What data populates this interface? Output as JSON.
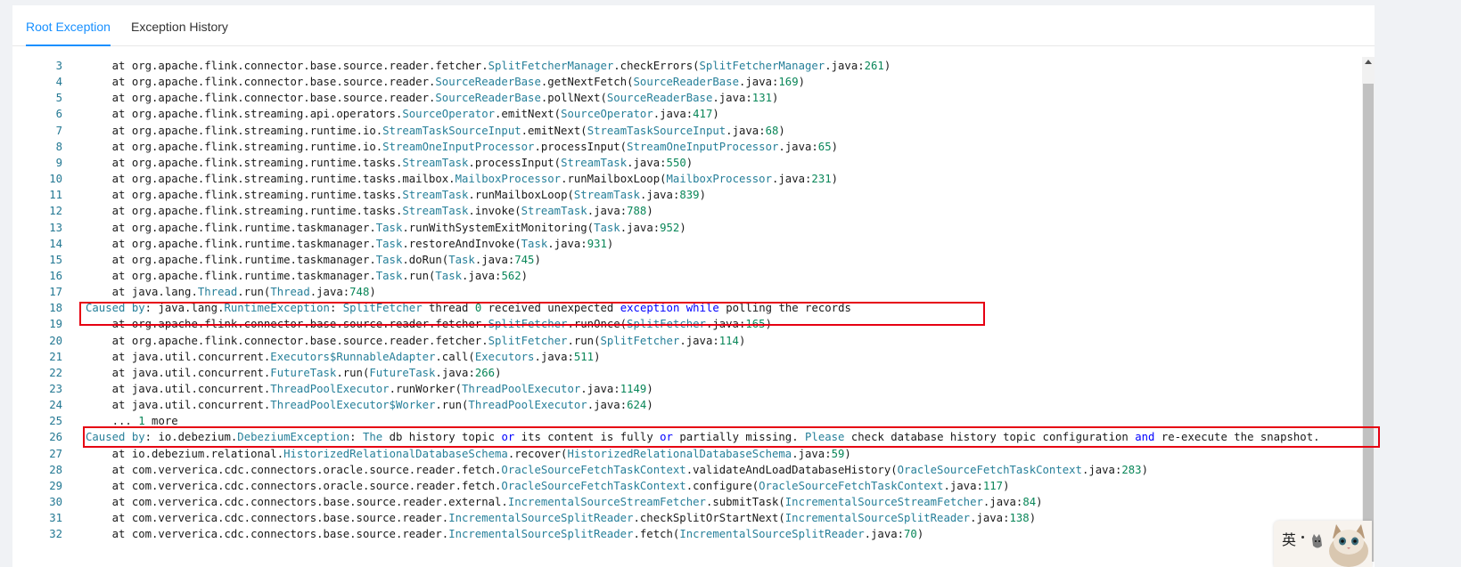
{
  "tabs": [
    {
      "label": "Root Exception",
      "active": true
    },
    {
      "label": "Exception History",
      "active": false
    }
  ],
  "colors": {
    "accent": "#1890ff",
    "line_number": "#237893",
    "class_token": "#267f99",
    "number_token": "#098658",
    "keyword_token": "#0000ff",
    "highlight_box": "#e60012"
  },
  "editor": {
    "highlighted_lines": [
      "18",
      "26"
    ],
    "lines": [
      {
        "num": "3",
        "tokens": [
          {
            "t": "    at org.apache.flink.connector.base.source.reader.fetcher."
          },
          {
            "t": "SplitFetcherManager",
            "s": "c"
          },
          {
            "t": ".checkErrors("
          },
          {
            "t": "SplitFetcherManager",
            "s": "c"
          },
          {
            "t": ".java:"
          },
          {
            "t": "261",
            "s": "n"
          },
          {
            "t": ")"
          }
        ]
      },
      {
        "num": "4",
        "tokens": [
          {
            "t": "    at org.apache.flink.connector.base.source.reader."
          },
          {
            "t": "SourceReaderBase",
            "s": "c"
          },
          {
            "t": ".getNextFetch("
          },
          {
            "t": "SourceReaderBase",
            "s": "c"
          },
          {
            "t": ".java:"
          },
          {
            "t": "169",
            "s": "n"
          },
          {
            "t": ")"
          }
        ]
      },
      {
        "num": "5",
        "tokens": [
          {
            "t": "    at org.apache.flink.connector.base.source.reader."
          },
          {
            "t": "SourceReaderBase",
            "s": "c"
          },
          {
            "t": ".pollNext("
          },
          {
            "t": "SourceReaderBase",
            "s": "c"
          },
          {
            "t": ".java:"
          },
          {
            "t": "131",
            "s": "n"
          },
          {
            "t": ")"
          }
        ]
      },
      {
        "num": "6",
        "tokens": [
          {
            "t": "    at org.apache.flink.streaming.api.operators."
          },
          {
            "t": "SourceOperator",
            "s": "c"
          },
          {
            "t": ".emitNext("
          },
          {
            "t": "SourceOperator",
            "s": "c"
          },
          {
            "t": ".java:"
          },
          {
            "t": "417",
            "s": "n"
          },
          {
            "t": ")"
          }
        ]
      },
      {
        "num": "7",
        "tokens": [
          {
            "t": "    at org.apache.flink.streaming.runtime.io."
          },
          {
            "t": "StreamTaskSourceInput",
            "s": "c"
          },
          {
            "t": ".emitNext("
          },
          {
            "t": "StreamTaskSourceInput",
            "s": "c"
          },
          {
            "t": ".java:"
          },
          {
            "t": "68",
            "s": "n"
          },
          {
            "t": ")"
          }
        ]
      },
      {
        "num": "8",
        "tokens": [
          {
            "t": "    at org.apache.flink.streaming.runtime.io."
          },
          {
            "t": "StreamOneInputProcessor",
            "s": "c"
          },
          {
            "t": ".processInput("
          },
          {
            "t": "StreamOneInputProcessor",
            "s": "c"
          },
          {
            "t": ".java:"
          },
          {
            "t": "65",
            "s": "n"
          },
          {
            "t": ")"
          }
        ]
      },
      {
        "num": "9",
        "tokens": [
          {
            "t": "    at org.apache.flink.streaming.runtime.tasks."
          },
          {
            "t": "StreamTask",
            "s": "c"
          },
          {
            "t": ".processInput("
          },
          {
            "t": "StreamTask",
            "s": "c"
          },
          {
            "t": ".java:"
          },
          {
            "t": "550",
            "s": "n"
          },
          {
            "t": ")"
          }
        ]
      },
      {
        "num": "10",
        "tokens": [
          {
            "t": "    at org.apache.flink.streaming.runtime.tasks.mailbox."
          },
          {
            "t": "MailboxProcessor",
            "s": "c"
          },
          {
            "t": ".runMailboxLoop("
          },
          {
            "t": "MailboxProcessor",
            "s": "c"
          },
          {
            "t": ".java:"
          },
          {
            "t": "231",
            "s": "n"
          },
          {
            "t": ")"
          }
        ]
      },
      {
        "num": "11",
        "tokens": [
          {
            "t": "    at org.apache.flink.streaming.runtime.tasks."
          },
          {
            "t": "StreamTask",
            "s": "c"
          },
          {
            "t": ".runMailboxLoop("
          },
          {
            "t": "StreamTask",
            "s": "c"
          },
          {
            "t": ".java:"
          },
          {
            "t": "839",
            "s": "n"
          },
          {
            "t": ")"
          }
        ]
      },
      {
        "num": "12",
        "tokens": [
          {
            "t": "    at org.apache.flink.streaming.runtime.tasks."
          },
          {
            "t": "StreamTask",
            "s": "c"
          },
          {
            "t": ".invoke("
          },
          {
            "t": "StreamTask",
            "s": "c"
          },
          {
            "t": ".java:"
          },
          {
            "t": "788",
            "s": "n"
          },
          {
            "t": ")"
          }
        ]
      },
      {
        "num": "13",
        "tokens": [
          {
            "t": "    at org.apache.flink.runtime.taskmanager."
          },
          {
            "t": "Task",
            "s": "c"
          },
          {
            "t": ".runWithSystemExitMonitoring("
          },
          {
            "t": "Task",
            "s": "c"
          },
          {
            "t": ".java:"
          },
          {
            "t": "952",
            "s": "n"
          },
          {
            "t": ")"
          }
        ]
      },
      {
        "num": "14",
        "tokens": [
          {
            "t": "    at org.apache.flink.runtime.taskmanager."
          },
          {
            "t": "Task",
            "s": "c"
          },
          {
            "t": ".restoreAndInvoke("
          },
          {
            "t": "Task",
            "s": "c"
          },
          {
            "t": ".java:"
          },
          {
            "t": "931",
            "s": "n"
          },
          {
            "t": ")"
          }
        ]
      },
      {
        "num": "15",
        "tokens": [
          {
            "t": "    at org.apache.flink.runtime.taskmanager."
          },
          {
            "t": "Task",
            "s": "c"
          },
          {
            "t": ".doRun("
          },
          {
            "t": "Task",
            "s": "c"
          },
          {
            "t": ".java:"
          },
          {
            "t": "745",
            "s": "n"
          },
          {
            "t": ")"
          }
        ]
      },
      {
        "num": "16",
        "tokens": [
          {
            "t": "    at org.apache.flink.runtime.taskmanager."
          },
          {
            "t": "Task",
            "s": "c"
          },
          {
            "t": ".run("
          },
          {
            "t": "Task",
            "s": "c"
          },
          {
            "t": ".java:"
          },
          {
            "t": "562",
            "s": "n"
          },
          {
            "t": ")"
          }
        ]
      },
      {
        "num": "17",
        "tokens": [
          {
            "t": "    at java.lang."
          },
          {
            "t": "Thread",
            "s": "c"
          },
          {
            "t": ".run("
          },
          {
            "t": "Thread",
            "s": "c"
          },
          {
            "t": ".java:"
          },
          {
            "t": "748",
            "s": "n"
          },
          {
            "t": ")"
          }
        ]
      },
      {
        "num": "18",
        "tokens": [
          {
            "t": "Caused by",
            "s": "c"
          },
          {
            "t": ": java.lang."
          },
          {
            "t": "RuntimeException",
            "s": "c"
          },
          {
            "t": ": "
          },
          {
            "t": "SplitFetcher",
            "s": "c"
          },
          {
            "t": " thread "
          },
          {
            "t": "0",
            "s": "n"
          },
          {
            "t": " received unexpected "
          },
          {
            "t": "exception",
            "s": "k"
          },
          {
            "t": " "
          },
          {
            "t": "while",
            "s": "k"
          },
          {
            "t": " polling the records"
          }
        ]
      },
      {
        "num": "19",
        "tokens": [
          {
            "t": "    at org.apache.flink.connector.base.source.reader.fetcher."
          },
          {
            "t": "SplitFetcher",
            "s": "c"
          },
          {
            "t": ".runOnce("
          },
          {
            "t": "SplitFetcher",
            "s": "c"
          },
          {
            "t": ".java:"
          },
          {
            "t": "165",
            "s": "n"
          },
          {
            "t": ")"
          }
        ]
      },
      {
        "num": "20",
        "tokens": [
          {
            "t": "    at org.apache.flink.connector.base.source.reader.fetcher."
          },
          {
            "t": "SplitFetcher",
            "s": "c"
          },
          {
            "t": ".run("
          },
          {
            "t": "SplitFetcher",
            "s": "c"
          },
          {
            "t": ".java:"
          },
          {
            "t": "114",
            "s": "n"
          },
          {
            "t": ")"
          }
        ]
      },
      {
        "num": "21",
        "tokens": [
          {
            "t": "    at java.util.concurrent."
          },
          {
            "t": "Executors$RunnableAdapter",
            "s": "c"
          },
          {
            "t": ".call("
          },
          {
            "t": "Executors",
            "s": "c"
          },
          {
            "t": ".java:"
          },
          {
            "t": "511",
            "s": "n"
          },
          {
            "t": ")"
          }
        ]
      },
      {
        "num": "22",
        "tokens": [
          {
            "t": "    at java.util.concurrent."
          },
          {
            "t": "FutureTask",
            "s": "c"
          },
          {
            "t": ".run("
          },
          {
            "t": "FutureTask",
            "s": "c"
          },
          {
            "t": ".java:"
          },
          {
            "t": "266",
            "s": "n"
          },
          {
            "t": ")"
          }
        ]
      },
      {
        "num": "23",
        "tokens": [
          {
            "t": "    at java.util.concurrent."
          },
          {
            "t": "ThreadPoolExecutor",
            "s": "c"
          },
          {
            "t": ".runWorker("
          },
          {
            "t": "ThreadPoolExecutor",
            "s": "c"
          },
          {
            "t": ".java:"
          },
          {
            "t": "1149",
            "s": "n"
          },
          {
            "t": ")"
          }
        ]
      },
      {
        "num": "24",
        "tokens": [
          {
            "t": "    at java.util.concurrent."
          },
          {
            "t": "ThreadPoolExecutor$Worker",
            "s": "c"
          },
          {
            "t": ".run("
          },
          {
            "t": "ThreadPoolExecutor",
            "s": "c"
          },
          {
            "t": ".java:"
          },
          {
            "t": "624",
            "s": "n"
          },
          {
            "t": ")"
          }
        ]
      },
      {
        "num": "25",
        "tokens": [
          {
            "t": "    ... "
          },
          {
            "t": "1",
            "s": "n"
          },
          {
            "t": " more"
          }
        ]
      },
      {
        "num": "26",
        "tokens": [
          {
            "t": "Caused by",
            "s": "c"
          },
          {
            "t": ": io.debezium."
          },
          {
            "t": "DebeziumException",
            "s": "c"
          },
          {
            "t": ": "
          },
          {
            "t": "The",
            "s": "c"
          },
          {
            "t": " db history topic "
          },
          {
            "t": "or",
            "s": "k"
          },
          {
            "t": " its content is fully "
          },
          {
            "t": "or",
            "s": "k"
          },
          {
            "t": " partially missing. "
          },
          {
            "t": "Please",
            "s": "c"
          },
          {
            "t": " check database history topic configuration "
          },
          {
            "t": "and",
            "s": "k"
          },
          {
            "t": " re-execute the snapshot."
          }
        ]
      },
      {
        "num": "27",
        "tokens": [
          {
            "t": "    at io.debezium.relational."
          },
          {
            "t": "HistorizedRelationalDatabaseSchema",
            "s": "c"
          },
          {
            "t": ".recover("
          },
          {
            "t": "HistorizedRelationalDatabaseSchema",
            "s": "c"
          },
          {
            "t": ".java:"
          },
          {
            "t": "59",
            "s": "n"
          },
          {
            "t": ")"
          }
        ]
      },
      {
        "num": "28",
        "tokens": [
          {
            "t": "    at com.ververica.cdc.connectors.oracle.source.reader.fetch."
          },
          {
            "t": "OracleSourceFetchTaskContext",
            "s": "c"
          },
          {
            "t": ".validateAndLoadDatabaseHistory("
          },
          {
            "t": "OracleSourceFetchTaskContext",
            "s": "c"
          },
          {
            "t": ".java:"
          },
          {
            "t": "283",
            "s": "n"
          },
          {
            "t": ")"
          }
        ]
      },
      {
        "num": "29",
        "tokens": [
          {
            "t": "    at com.ververica.cdc.connectors.oracle.source.reader.fetch."
          },
          {
            "t": "OracleSourceFetchTaskContext",
            "s": "c"
          },
          {
            "t": ".configure("
          },
          {
            "t": "OracleSourceFetchTaskContext",
            "s": "c"
          },
          {
            "t": ".java:"
          },
          {
            "t": "117",
            "s": "n"
          },
          {
            "t": ")"
          }
        ]
      },
      {
        "num": "30",
        "tokens": [
          {
            "t": "    at com.ververica.cdc.connectors.base.source.reader.external."
          },
          {
            "t": "IncrementalSourceStreamFetcher",
            "s": "c"
          },
          {
            "t": ".submitTask("
          },
          {
            "t": "IncrementalSourceStreamFetcher",
            "s": "c"
          },
          {
            "t": ".java:"
          },
          {
            "t": "84",
            "s": "n"
          },
          {
            "t": ")"
          }
        ]
      },
      {
        "num": "31",
        "tokens": [
          {
            "t": "    at com.ververica.cdc.connectors.base.source.reader."
          },
          {
            "t": "IncrementalSourceSplitReader",
            "s": "c"
          },
          {
            "t": ".checkSplitOrStartNext("
          },
          {
            "t": "IncrementalSourceSplitReader",
            "s": "c"
          },
          {
            "t": ".java:"
          },
          {
            "t": "138",
            "s": "n"
          },
          {
            "t": ")"
          }
        ]
      },
      {
        "num": "32",
        "tokens": [
          {
            "t": "    at com.ververica.cdc.connectors.base.source.reader."
          },
          {
            "t": "IncrementalSourceSplitReader",
            "s": "c"
          },
          {
            "t": ".fetch("
          },
          {
            "t": "IncrementalSourceSplitReader",
            "s": "c"
          },
          {
            "t": ".java:"
          },
          {
            "t": "70",
            "s": "n"
          },
          {
            "t": ")"
          }
        ]
      }
    ]
  },
  "scrollbar": {
    "up_arrow_icon": "chevron-up-icon"
  },
  "ime_widget": {
    "label": "英",
    "icons": [
      "cat-icon",
      "kitten-icon"
    ]
  }
}
